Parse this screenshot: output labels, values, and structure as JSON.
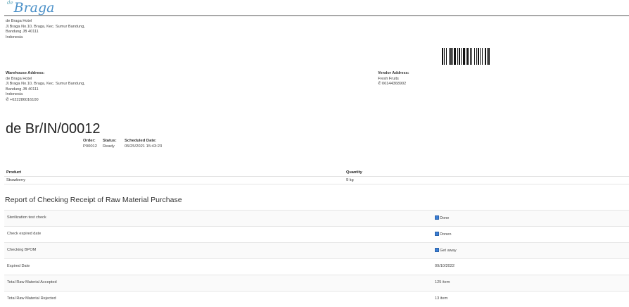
{
  "logo": {
    "prefix": "de",
    "name": "Braga"
  },
  "company_address": {
    "lines": [
      "de Braga Hotel",
      "Jl.Braga No.10, Braga, Kec. Sumur Bandung,",
      "Bandung JB 40111",
      "Indonesia"
    ]
  },
  "warehouse": {
    "label": "Warehouse Address:",
    "lines": [
      "de Braga Hotel",
      "Jl.Braga No.10, Braga, Kec. Sumur Bandung,",
      "Bandung JB 40111",
      "Indonesia"
    ],
    "phone": "+622286016100"
  },
  "vendor": {
    "label": "Vendor Address:",
    "name": "Fresh Fruits",
    "phone": "06144368902"
  },
  "document": {
    "name": "de Br/IN/00012",
    "order_label": "Order:",
    "order": "P00012",
    "status_label": "Status:",
    "status": "Ready",
    "scheduled_label": "Scheduled Date:",
    "scheduled": "05/25/2021 15:43:23"
  },
  "product_table": {
    "headers": {
      "product": "Product",
      "quantity": "Quantity"
    },
    "rows": [
      {
        "product": "Strawberry",
        "quantity": "9 kg"
      }
    ]
  },
  "report": {
    "title": "Report of Checking Receipt of Raw Material Purchase",
    "rows": [
      {
        "label": "Sterilization test check",
        "value": "Done",
        "checkbox": true
      },
      {
        "label": "Check expired date",
        "value": "Donen",
        "checkbox": true
      },
      {
        "label": "Checking BPOM",
        "value": "Get away",
        "checkbox": true
      },
      {
        "label": "Expired Date",
        "value": "09/10/2022",
        "checkbox": false
      },
      {
        "label": "Total Raw Material Accepted",
        "value": "125 item",
        "checkbox": false
      },
      {
        "label": "Total Raw Material Rejected",
        "value": "13 item",
        "checkbox": false
      }
    ]
  },
  "icons": {
    "phone": "phone-icon",
    "barcode": "barcode-icon",
    "checkbox": "checkbox-checked-icon"
  }
}
